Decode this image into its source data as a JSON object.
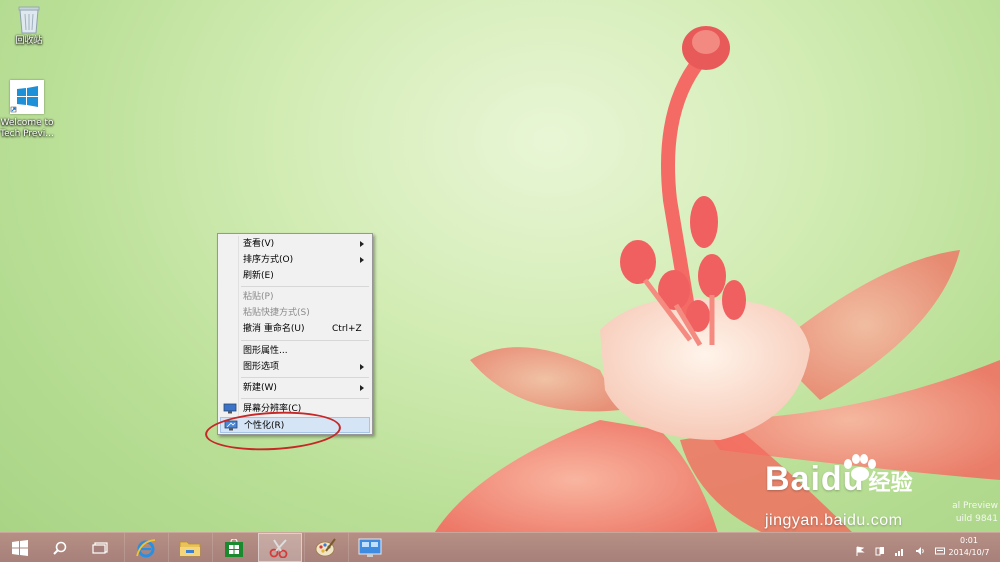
{
  "desktop": {
    "icons": [
      {
        "name": "recycle-bin",
        "label": "回收站"
      },
      {
        "name": "welcome",
        "label": "Welcome to Tech Previ..."
      }
    ]
  },
  "context_menu": {
    "items": [
      {
        "label": "查看(V)",
        "submenu": true
      },
      {
        "label": "排序方式(O)",
        "submenu": true
      },
      {
        "label": "刷新(E)"
      },
      {
        "label": "粘贴(P)",
        "disabled": true
      },
      {
        "label": "粘贴快捷方式(S)",
        "disabled": true
      },
      {
        "label": "撤消 重命名(U)",
        "shortcut": "Ctrl+Z"
      },
      {
        "label": "图形属性..."
      },
      {
        "label": "图形选项",
        "submenu": true
      },
      {
        "label": "新建(W)",
        "submenu": true
      },
      {
        "label": "屏幕分辨率(C)",
        "icon": "screen-resolution-icon"
      },
      {
        "label": "个性化(R)",
        "icon": "personalize-icon",
        "highlighted": true
      }
    ]
  },
  "watermark": {
    "brand_a": "Bai",
    "brand_b": "du",
    "brand_c": "经验",
    "url": "jingyan.baidu.com",
    "preview_line1": "al Preview",
    "preview_line2": "uild 9841"
  },
  "taskbar": {
    "buttons": [
      {
        "name": "start-button",
        "icon": "windows-logo-icon"
      },
      {
        "name": "search-button",
        "icon": "search-icon"
      },
      {
        "name": "task-view-button",
        "icon": "task-view-icon"
      },
      {
        "name": "ie-button",
        "icon": "internet-explorer-icon"
      },
      {
        "name": "file-explorer-button",
        "icon": "folder-icon"
      },
      {
        "name": "store-button",
        "icon": "store-icon"
      },
      {
        "name": "snipping-tool-button",
        "icon": "scissors-icon",
        "active": true
      },
      {
        "name": "paint-button",
        "icon": "paint-palette-icon"
      },
      {
        "name": "remote-desktop-button",
        "icon": "remote-desktop-icon"
      }
    ],
    "clock": {
      "time": "0:01",
      "date": "2014/10/7"
    }
  },
  "colors": {
    "taskbar": "#a6807a",
    "menu_highlight": "#d5e5f5",
    "annotation": "#c62828",
    "store_green": "#1b8a2e"
  }
}
